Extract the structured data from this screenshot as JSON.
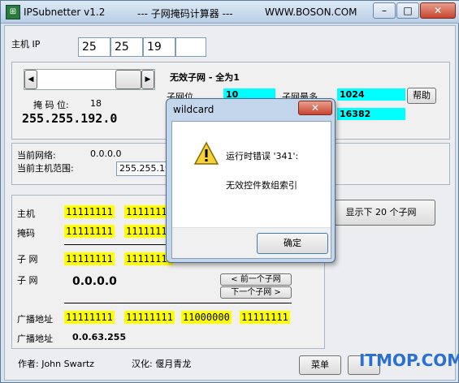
{
  "window": {
    "app_title": "IPSubnetter v1.2",
    "mid_title": "--- 子网掩码计算器 ---",
    "url": "WWW.BOSON.COM"
  },
  "host_ip": {
    "label": "主机 IP",
    "octets": [
      "25",
      "25",
      "19",
      ""
    ]
  },
  "subnet_info": {
    "invalid_title": "无效子网 - 全为1",
    "subnet_bits_label": "子网位",
    "subnet_bits_value": "10",
    "max_subnets_label": "子网最多",
    "max_subnets_value": "1024",
    "max_hosts_value": "16382",
    "help_label": "帮助",
    "mask_bits_label": "掩 码 位:",
    "mask_bits_value": "18",
    "mask_value": "255.255.192.0",
    "row2_label_fragment": "主"
  },
  "network": {
    "current_network_label": "当前网络:",
    "current_network_value": "0.0.0.0",
    "host_range_label": "当前主机范围:",
    "host_range_value": "255.255.19"
  },
  "binary": {
    "host_label": "主机",
    "host_bits": [
      "11111111",
      "1111111"
    ],
    "mask_label": "掩码",
    "mask_bits": [
      "11111111",
      "1111111"
    ],
    "subnet_label": "子 网",
    "subnet_bits": [
      "11111111",
      "1111111"
    ],
    "subnet2_label": "子 网",
    "subnet_value": "0.0.0.0",
    "prev_subnet_label": "< 前一个子网",
    "next_subnet_label": "下一个子网 >",
    "show_next_label": "显示下 20 个子网",
    "broadcast_label": "广播地址",
    "broadcast_bits": [
      "11111111",
      "11111111",
      "11000000",
      "11111111"
    ],
    "broadcast2_label": "广播地址",
    "broadcast_value": "0.0.63.255"
  },
  "footer": {
    "author": "作者: John Swartz",
    "localized": "汉化: 偃月青龙",
    "menu_label": "菜单",
    "watermark": "ITMOP.COM"
  },
  "dialog": {
    "title": "wildcard",
    "error_line": "运行时错误 '341':",
    "message": "无效控件数组索引",
    "ok_label": "确定"
  },
  "colors": {
    "highlight_yellow": "#ffff00",
    "highlight_cyan": "#00ffff",
    "watermark_blue": "#2b6fd0"
  }
}
